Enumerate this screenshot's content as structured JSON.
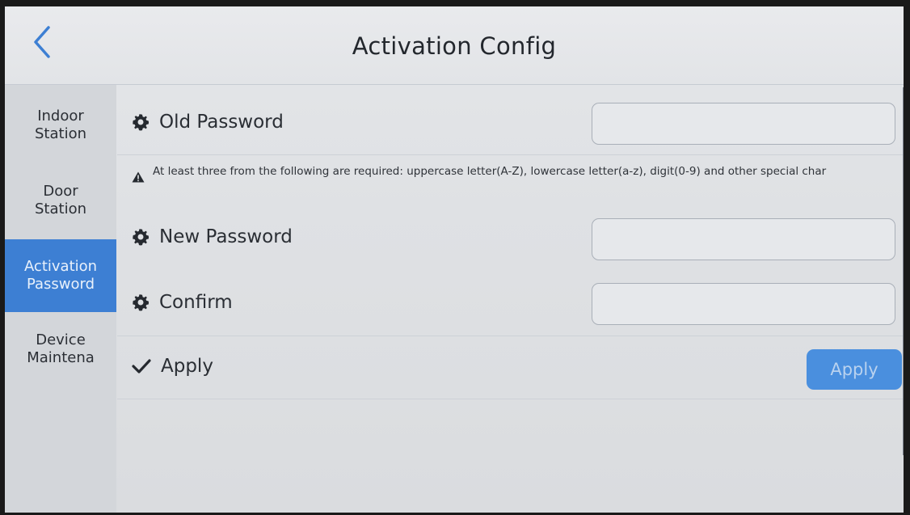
{
  "header": {
    "title": "Activation Config",
    "back_icon": "chevron-left-icon"
  },
  "sidebar": {
    "items": [
      {
        "label": "Indoor\nStation",
        "active": false
      },
      {
        "label": "Door\nStation",
        "active": false
      },
      {
        "label": "Activation\nPassword",
        "active": true
      },
      {
        "label": "Device\nMaintena",
        "active": false
      }
    ]
  },
  "form": {
    "old_password": {
      "label": "Old Password",
      "icon": "gear-icon",
      "value": ""
    },
    "notice": {
      "icon": "warning-icon",
      "text": "At least three from the following are required: uppercase letter(A-Z), lowercase letter(a-z), digit(0-9) and other special char"
    },
    "new_password": {
      "label": "New Password",
      "icon": "gear-icon",
      "value": ""
    },
    "confirm": {
      "label": "Confirm",
      "icon": "gear-icon",
      "value": ""
    },
    "apply": {
      "label": "Apply",
      "icon": "check-icon",
      "button_label": "Apply"
    }
  },
  "colors": {
    "accent": "#3d7fd3",
    "button": "#4a8fde",
    "background": "#e2e4e7"
  }
}
